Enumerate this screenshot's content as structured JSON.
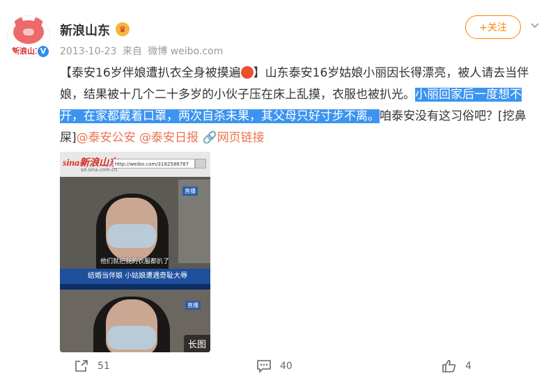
{
  "header": {
    "username": "新浪山东",
    "avatar_text": "新浪山东",
    "date": "2013-10-23",
    "source_prefix": "来自",
    "source": "微博 weibo.com",
    "follow_label": "+关注"
  },
  "post": {
    "part1": "【泰安16岁伴娘遭扒衣全身被摸遍",
    "part2": "】山东泰安16岁姑娘小丽因长得漂亮，被人请去当伴娘，结果被十几个二十多岁的小伙子压在床上乱摸，衣服也被扒光。",
    "highlighted": "小丽回家后一度想不开，在家都戴着口罩，两次自杀未果，其父母只好寸步不离。",
    "part3": "咱泰安没有这习俗吧？[挖鼻屎]",
    "mention1": "@泰安公安",
    "mention2": "@泰安日报",
    "web_link": "网页链接"
  },
  "media": {
    "sina_logo": "sina新浪山东",
    "sina_domain": "sd.sina.com.cn",
    "url_text": "http://weibo.com/3182588787",
    "live_label": "直播",
    "subtitle": "他们就把我的衣服都扒了",
    "ticker_text": "结婚当伴娘  小姑娘遭遇奇耻大辱",
    "long_image_label": "长图"
  },
  "actions": {
    "repost_count": "51",
    "comment_count": "40",
    "like_count": "4"
  },
  "colors": {
    "accent": "#ff8200",
    "highlight": "#3c94f0",
    "link": "#eb7350"
  }
}
